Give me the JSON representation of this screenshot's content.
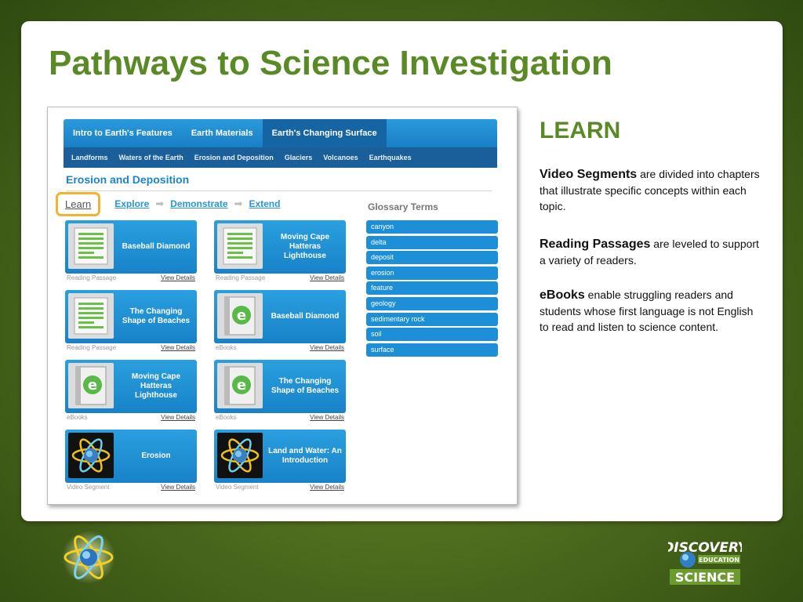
{
  "slide": {
    "title": "Pathways to Science Investigation"
  },
  "screenshot": {
    "nav_tabs": [
      {
        "label": "Intro to Earth's Features",
        "active": false
      },
      {
        "label": "Earth Materials",
        "active": false
      },
      {
        "label": "Earth's Changing Surface",
        "active": true
      }
    ],
    "subnav_items": [
      "Landforms",
      "Waters of the Earth",
      "Erosion and Deposition",
      "Glaciers",
      "Volcanoes",
      "Earthquakes"
    ],
    "section_heading": "Erosion and Deposition",
    "steps": [
      "Learn",
      "Explore",
      "Demonstrate",
      "Extend"
    ],
    "glossary": {
      "title": "Glossary Terms",
      "terms": [
        "canyon",
        "delta",
        "deposit",
        "erosion",
        "feature",
        "geology",
        "sedimentary rock",
        "soil",
        "surface"
      ]
    },
    "tiles": [
      {
        "title": "Baseball Diamond",
        "type": "Reading Passage",
        "link": "View Details",
        "icon": "reading-passage-icon"
      },
      {
        "title": "Moving Cape Hatteras Lighthouse",
        "type": "Reading Passage",
        "link": "View Details",
        "icon": "reading-passage-icon"
      },
      {
        "title": "The Changing Shape of Beaches",
        "type": "Reading Passage",
        "link": "View Details",
        "icon": "reading-passage-icon"
      },
      {
        "title": "Baseball Diamond",
        "type": "eBooks",
        "link": "View Details",
        "icon": "ebook-icon"
      },
      {
        "title": "Moving Cape Hatteras Lighthouse",
        "type": "eBooks",
        "link": "View Details",
        "icon": "ebook-icon"
      },
      {
        "title": "The Changing Shape of Beaches",
        "type": "eBooks",
        "link": "View Details",
        "icon": "ebook-icon"
      },
      {
        "title": "Erosion",
        "type": "Video Segment",
        "link": "View Details",
        "icon": "video-atom-icon"
      },
      {
        "title": "Land and Water: An Introduction",
        "type": "Video Segment",
        "link": "View Details",
        "icon": "video-atom-icon"
      }
    ]
  },
  "learn": {
    "heading": "LEARN",
    "paragraphs": [
      {
        "bold": "Video Segments",
        "text": " are divided into chapters that illustrate specific concepts within each topic."
      },
      {
        "bold": "Reading Passages",
        "text": " are leveled to support a variety of readers."
      },
      {
        "bold": "eBooks",
        "text": " enable struggling readers and students whose first language is not English to read and listen to science content."
      }
    ]
  },
  "branding": {
    "discovery": "DISCOVERY",
    "education": "EDUCATION",
    "science": "SCIENCE"
  },
  "colors": {
    "title_green": "#5a8a25",
    "nav_blue": "#1a7fc4",
    "tile_blue": "#1882c8",
    "learn_highlight": "#f5b22c"
  }
}
